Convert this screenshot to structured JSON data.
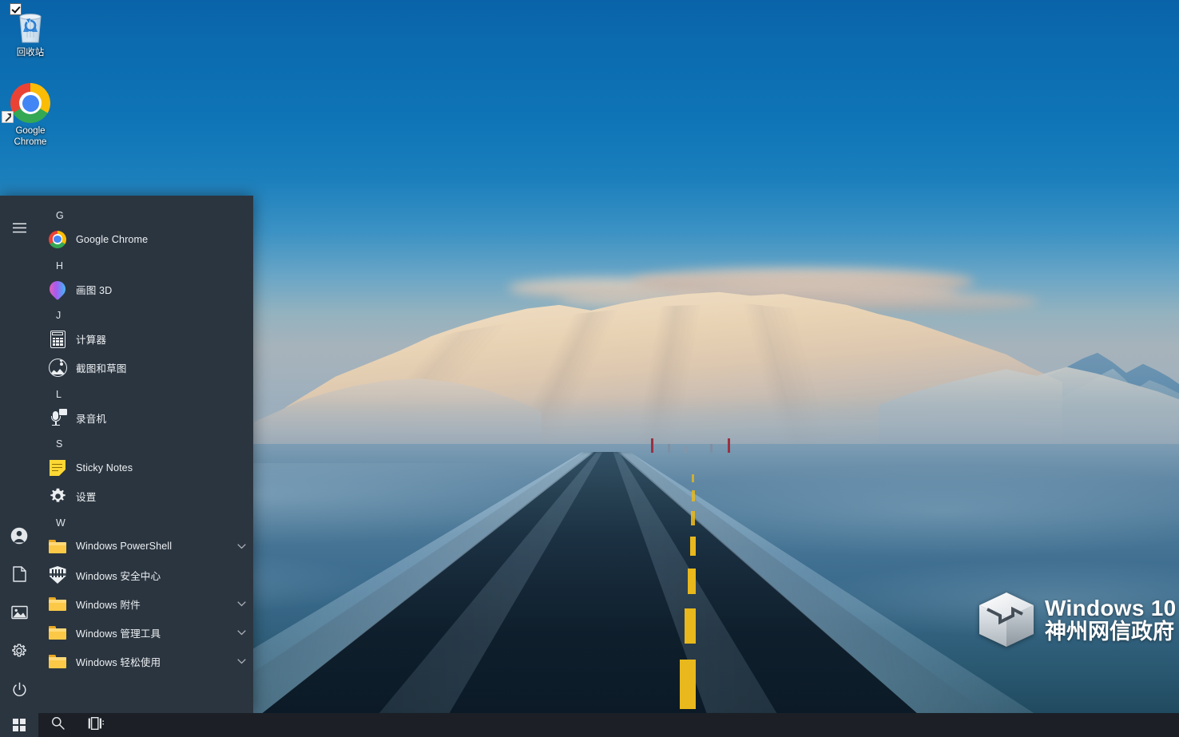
{
  "desktop": {
    "icons": [
      {
        "id": "recycle-bin",
        "label": "回收站",
        "icon": "recycle-bin-icon",
        "checked": true
      },
      {
        "id": "google-chrome",
        "label": "Google Chrome",
        "icon": "chrome-icon",
        "shortcut": true
      }
    ]
  },
  "watermark": {
    "line1": "Windows 10",
    "line2": "神州网信政府",
    "logo": "windows-cube-logo"
  },
  "start_menu": {
    "rail": {
      "top": [
        {
          "id": "hamburger",
          "icon": "hamburger-menu-icon",
          "label": "展开"
        }
      ],
      "bottom": [
        {
          "id": "user",
          "icon": "user-account-icon",
          "label": "用户"
        },
        {
          "id": "documents",
          "icon": "documents-icon",
          "label": "文档"
        },
        {
          "id": "pictures",
          "icon": "pictures-icon",
          "label": "图片"
        },
        {
          "id": "settings",
          "icon": "gear-icon",
          "label": "设置"
        },
        {
          "id": "power",
          "icon": "power-icon",
          "label": "电源"
        }
      ]
    },
    "groups": [
      {
        "letter": "G",
        "items": [
          {
            "label": "Google Chrome",
            "icon": "chrome-icon",
            "expandable": false
          }
        ]
      },
      {
        "letter": "H",
        "items": [
          {
            "label": "画图 3D",
            "icon": "paint3d-icon",
            "expandable": false
          }
        ]
      },
      {
        "letter": "J",
        "items": [
          {
            "label": "计算器",
            "icon": "calculator-icon",
            "expandable": false
          },
          {
            "label": "截图和草图",
            "icon": "snip-sketch-icon",
            "expandable": false
          }
        ]
      },
      {
        "letter": "L",
        "items": [
          {
            "label": "录音机",
            "icon": "voice-recorder-icon",
            "expandable": false
          }
        ]
      },
      {
        "letter": "S",
        "items": [
          {
            "label": "Sticky Notes",
            "icon": "sticky-notes-icon",
            "expandable": false
          },
          {
            "label": "设置",
            "icon": "gear-icon",
            "expandable": false
          }
        ]
      },
      {
        "letter": "W",
        "items": [
          {
            "label": "Windows PowerShell",
            "icon": "folder-icon",
            "expandable": true
          },
          {
            "label": "Windows 安全中心",
            "icon": "shield-icon",
            "expandable": false
          },
          {
            "label": "Windows 附件",
            "icon": "folder-icon",
            "expandable": true
          },
          {
            "label": "Windows 管理工具",
            "icon": "folder-icon",
            "expandable": true
          },
          {
            "label": "Windows 轻松使用",
            "icon": "folder-icon",
            "expandable": true
          }
        ]
      }
    ]
  },
  "taskbar": {
    "buttons": [
      {
        "id": "start",
        "icon": "windows-start-icon",
        "label": "开始"
      },
      {
        "id": "search",
        "icon": "search-icon",
        "label": "搜索"
      },
      {
        "id": "task-view",
        "icon": "task-view-icon",
        "label": "任务视图"
      }
    ]
  },
  "colors": {
    "start_menu_bg": "#2b3540",
    "taskbar_bg": "#1c2026",
    "sky": "#0a6cae",
    "accent_yellow": "#fbc947",
    "text": "#eceff1"
  }
}
